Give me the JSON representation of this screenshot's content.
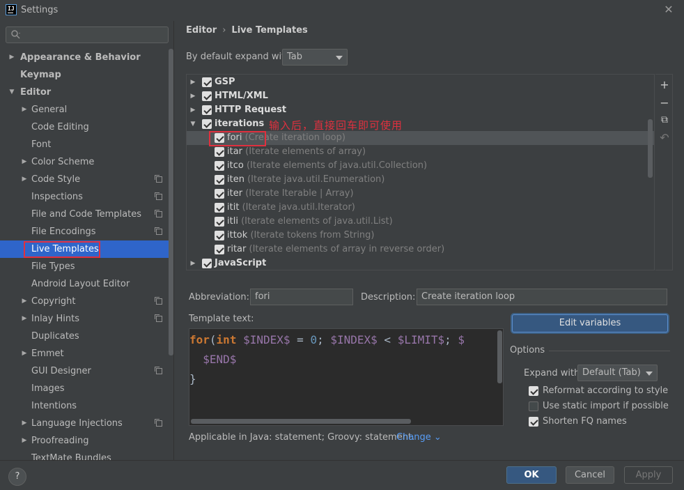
{
  "window": {
    "title": "Settings",
    "close": "✕"
  },
  "search": {
    "placeholder": ""
  },
  "sidebar": {
    "items": [
      {
        "label": "Appearance & Behavior",
        "arrow": "▶",
        "bold": true,
        "indent": 0
      },
      {
        "label": "Keymap",
        "arrow": "",
        "bold": true,
        "indent": 0
      },
      {
        "label": "Editor",
        "arrow": "▼",
        "bold": true,
        "indent": 0
      },
      {
        "label": "General",
        "arrow": "▶",
        "indent": 1
      },
      {
        "label": "Code Editing",
        "arrow": "",
        "indent": 1
      },
      {
        "label": "Font",
        "arrow": "",
        "indent": 1
      },
      {
        "label": "Color Scheme",
        "arrow": "▶",
        "indent": 1
      },
      {
        "label": "Code Style",
        "arrow": "▶",
        "indent": 1,
        "project": true
      },
      {
        "label": "Inspections",
        "arrow": "",
        "indent": 1,
        "project": true
      },
      {
        "label": "File and Code Templates",
        "arrow": "",
        "indent": 1,
        "project": true
      },
      {
        "label": "File Encodings",
        "arrow": "",
        "indent": 1,
        "project": true
      },
      {
        "label": "Live Templates",
        "arrow": "",
        "indent": 1,
        "selected": true
      },
      {
        "label": "File Types",
        "arrow": "",
        "indent": 1
      },
      {
        "label": "Android Layout Editor",
        "arrow": "",
        "indent": 1
      },
      {
        "label": "Copyright",
        "arrow": "▶",
        "indent": 1,
        "project": true
      },
      {
        "label": "Inlay Hints",
        "arrow": "▶",
        "indent": 1,
        "project": true
      },
      {
        "label": "Duplicates",
        "arrow": "",
        "indent": 1
      },
      {
        "label": "Emmet",
        "arrow": "▶",
        "indent": 1
      },
      {
        "label": "GUI Designer",
        "arrow": "",
        "indent": 1,
        "project": true
      },
      {
        "label": "Images",
        "arrow": "",
        "indent": 1
      },
      {
        "label": "Intentions",
        "arrow": "",
        "indent": 1
      },
      {
        "label": "Language Injections",
        "arrow": "▶",
        "indent": 1,
        "project": true
      },
      {
        "label": "Proofreading",
        "arrow": "▶",
        "indent": 1
      },
      {
        "label": "TextMate Bundles",
        "arrow": "",
        "indent": 1
      }
    ]
  },
  "breadcrumb": {
    "parent": "Editor",
    "sep": "›",
    "current": "Live Templates"
  },
  "expand_default": {
    "label": "By default expand with",
    "value": "Tab"
  },
  "templates": {
    "annotation": "输入后，直接回车即可使用",
    "rows": [
      {
        "name": "GSP",
        "group": true,
        "arrow": "▶",
        "checked": true
      },
      {
        "name": "HTML/XML",
        "group": true,
        "arrow": "▶",
        "checked": true
      },
      {
        "name": "HTTP Request",
        "group": true,
        "arrow": "▶",
        "checked": true
      },
      {
        "name": "iterations",
        "group": true,
        "arrow": "▼",
        "checked": true
      },
      {
        "name": "fori",
        "desc": "(Create iteration loop)",
        "checked": true,
        "selected": true
      },
      {
        "name": "itar",
        "desc": "(Iterate elements of array)",
        "checked": true
      },
      {
        "name": "itco",
        "desc": "(Iterate elements of java.util.Collection)",
        "checked": true
      },
      {
        "name": "iten",
        "desc": "(Iterate java.util.Enumeration)",
        "checked": true
      },
      {
        "name": "iter",
        "desc": "(Iterate Iterable | Array)",
        "checked": true
      },
      {
        "name": "itit",
        "desc": "(Iterate java.util.Iterator)",
        "checked": true
      },
      {
        "name": "itli",
        "desc": "(Iterate elements of java.util.List)",
        "checked": true
      },
      {
        "name": "ittok",
        "desc": "(Iterate tokens from String)",
        "checked": true
      },
      {
        "name": "ritar",
        "desc": "(Iterate elements of array in reverse order)",
        "checked": true
      },
      {
        "name": "JavaScript",
        "group": true,
        "arrow": "▶",
        "checked": true
      }
    ],
    "toolbar": {
      "add": "+",
      "remove": "−",
      "copy": "⧉",
      "restore": "↶"
    }
  },
  "abbreviation": {
    "label": "Abbreviation:",
    "value": "fori"
  },
  "description": {
    "label": "Description:",
    "value": "Create iteration loop"
  },
  "template_text": {
    "label": "Template text:",
    "lines": [
      "for(int $INDEX$ = 0; $INDEX$ < $LIMIT$; $",
      "  $END$",
      "}"
    ]
  },
  "applicable": {
    "text": "Applicable in Java: statement; Groovy: statement.",
    "change": "Change ⌄"
  },
  "edit_variables": "Edit variables",
  "options": {
    "title": "Options",
    "expand_with_label": "Expand with",
    "expand_with_value": "Default (Tab)",
    "checks": [
      {
        "label": "Reformat according to style",
        "checked": true
      },
      {
        "label": "Use static import if possible",
        "checked": false
      },
      {
        "label": "Shorten FQ names",
        "checked": true
      }
    ]
  },
  "buttons": {
    "help": "?",
    "ok": "OK",
    "cancel": "Cancel",
    "apply": "Apply"
  },
  "colors": {
    "selection": "#2f65ca",
    "accent_button": "#365880",
    "highlight_box": "#e0303e",
    "background": "#3c3f41"
  }
}
